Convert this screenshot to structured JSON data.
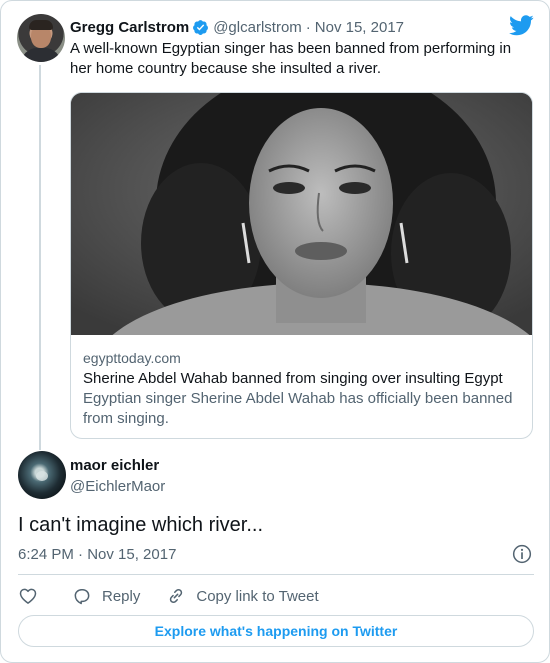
{
  "parent_tweet": {
    "author_name": "Gregg Carlstrom",
    "author_handle": "@glcarlstrom",
    "separator": "·",
    "date": "Nov 15, 2017",
    "text": "A well-known Egyptian singer has been banned from performing in her home country because she insulted a river.",
    "link_card": {
      "domain": "egypttoday.com",
      "title": "Sherine Abdel Wahab banned from singing over insulting Egypt",
      "description": "Egyptian singer Sherine Abdel Wahab has officially been banned from singing."
    }
  },
  "reply_tweet": {
    "author_name": "maor eichler",
    "author_handle": "@EichlerMaor",
    "text": "I can't imagine which river...",
    "timestamp": "6:24 PM · Nov 15, 2017"
  },
  "actions": {
    "reply_label": "Reply",
    "copy_label": "Copy link to Tweet"
  },
  "explore_label": "Explore what's happening on Twitter",
  "colors": {
    "brand_blue": "#1d9bf0",
    "secondary_text": "#536471",
    "border": "#cfd9de"
  },
  "icons": [
    "twitter-logo-icon",
    "verified-badge-icon",
    "info-icon",
    "heart-icon",
    "reply-bubble-icon",
    "link-icon"
  ]
}
